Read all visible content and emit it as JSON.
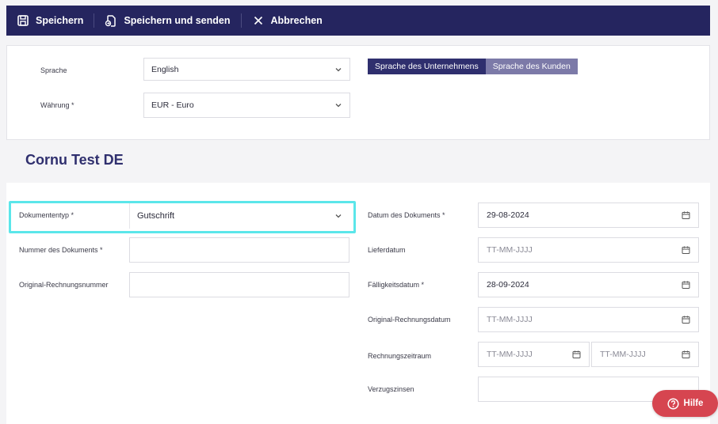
{
  "toolbar": {
    "save_label": "Speichern",
    "save_send_label": "Speichern und senden",
    "cancel_label": "Abbrechen",
    "background": "#25255f"
  },
  "settings": {
    "language_label": "Sprache",
    "language_value": "English",
    "currency_label": "Währung *",
    "currency_value": "EUR - Euro",
    "lang_toggle": {
      "company_label": "Sprache des Unternehmens",
      "customer_label": "Sprache des Kunden",
      "active": "company"
    }
  },
  "company_name": "Cornu Test DE",
  "form": {
    "left": {
      "doc_type_label": "Dokumententyp *",
      "doc_type_value": "Gutschrift",
      "doc_number_label": "Nummer des Dokuments *",
      "doc_number_value": "",
      "orig_invoice_number_label": "Original-Rechnungsnummer",
      "orig_invoice_number_value": ""
    },
    "right": {
      "doc_date_label": "Datum des Dokuments *",
      "doc_date_value": "29-08-2024",
      "delivery_date_label": "Lieferdatum",
      "delivery_date_placeholder": "TT-MM-JJJJ",
      "due_date_label": "Fälligkeitsdatum *",
      "due_date_value": "28-09-2024",
      "orig_invoice_date_label": "Original-Rechnungsdatum",
      "orig_invoice_date_placeholder": "TT-MM-JJJJ",
      "billing_period_label": "Rechnungszeitraum",
      "billing_period_from_placeholder": "TT-MM-JJJJ",
      "billing_period_to_placeholder": "TT-MM-JJJJ",
      "late_interest_label": "Verzugszinsen",
      "late_interest_value": ""
    }
  },
  "help_label": "Hilfe",
  "colors": {
    "accent": "#2f2f6e",
    "focus_highlight": "#5be6ea",
    "help_button": "#d64550"
  }
}
